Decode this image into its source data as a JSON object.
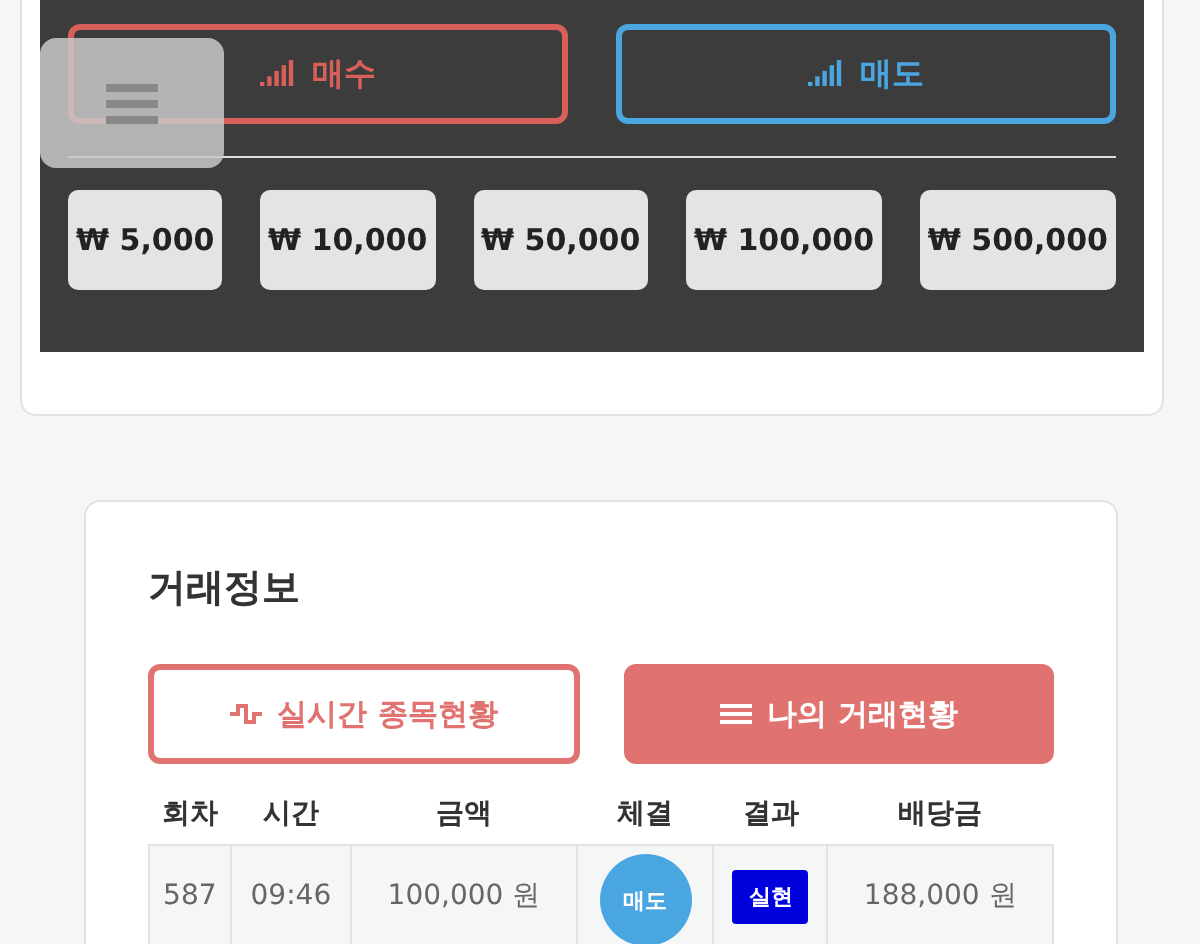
{
  "trade_panel": {
    "sides": [
      {
        "label": "매수",
        "kind": "buy"
      },
      {
        "label": "매도",
        "kind": "sell"
      }
    ],
    "amounts": [
      "₩ 5,000",
      "₩ 10,000",
      "₩ 50,000",
      "₩ 100,000",
      "₩ 500,000"
    ]
  },
  "trade_info": {
    "title": "거래정보",
    "tabs": [
      {
        "label": "실시간 종목현황",
        "selected": false,
        "kind": "pulse"
      },
      {
        "label": "나의 거래현황",
        "selected": true,
        "kind": "lines"
      }
    ],
    "columns": [
      "회차",
      "시간",
      "금액",
      "체결",
      "결과",
      "배당금"
    ],
    "rows": [
      {
        "round": "587",
        "time": "09:46",
        "amount": "100,000 원",
        "side": "매도",
        "result": "실현",
        "payout": "188,000 원"
      }
    ]
  }
}
